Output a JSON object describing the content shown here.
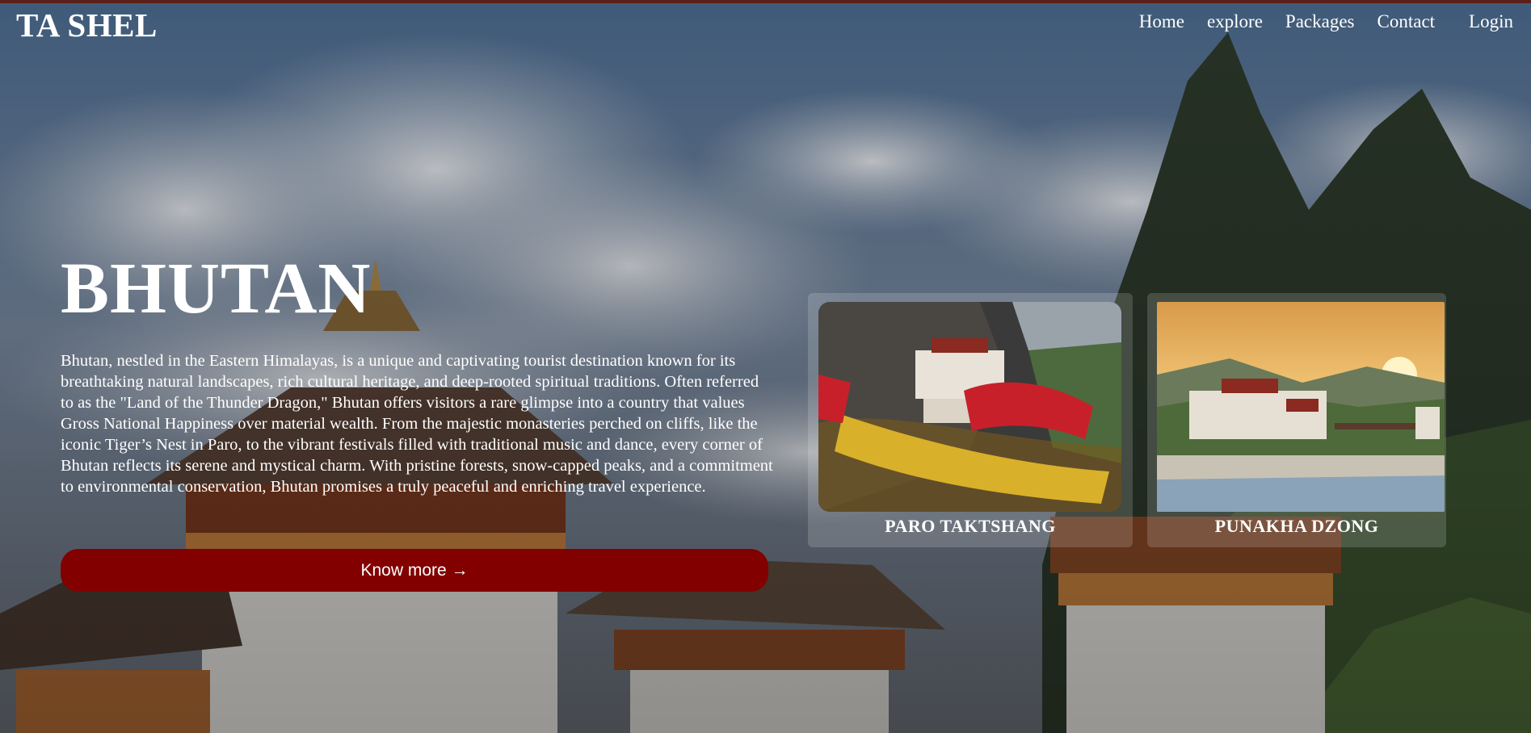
{
  "brand": "TA SHEL",
  "nav": {
    "home": "Home",
    "explore": "explore",
    "packages": "Packages",
    "contact": "Contact",
    "login": "Login"
  },
  "hero": {
    "title": "BHUTAN",
    "description": "Bhutan, nestled in the Eastern Himalayas, is a unique and captivating tourist destination known for its breathtaking natural landscapes, rich cultural heritage, and deep-rooted spiritual traditions. Often referred to as the \"Land of the Thunder Dragon,\" Bhutan offers visitors a rare glimpse into a country that values Gross National Happiness over material wealth. From the majestic monasteries perched on cliffs, like the iconic Tiger’s Nest in Paro, to the vibrant festivals filled with traditional music and dance, every corner of Bhutan reflects its serene and mystical charm. With pristine forests, snow-capped peaks, and a commitment to environmental conservation, Bhutan promises a truly peaceful and enriching travel experience.",
    "cta_label": "Know more →"
  },
  "cards": [
    {
      "label": "PARO TAKTSHANG"
    },
    {
      "label": "PUNAKHA DZONG"
    }
  ],
  "colors": {
    "cta": "#820000",
    "top_strip": "#5a1f18"
  }
}
